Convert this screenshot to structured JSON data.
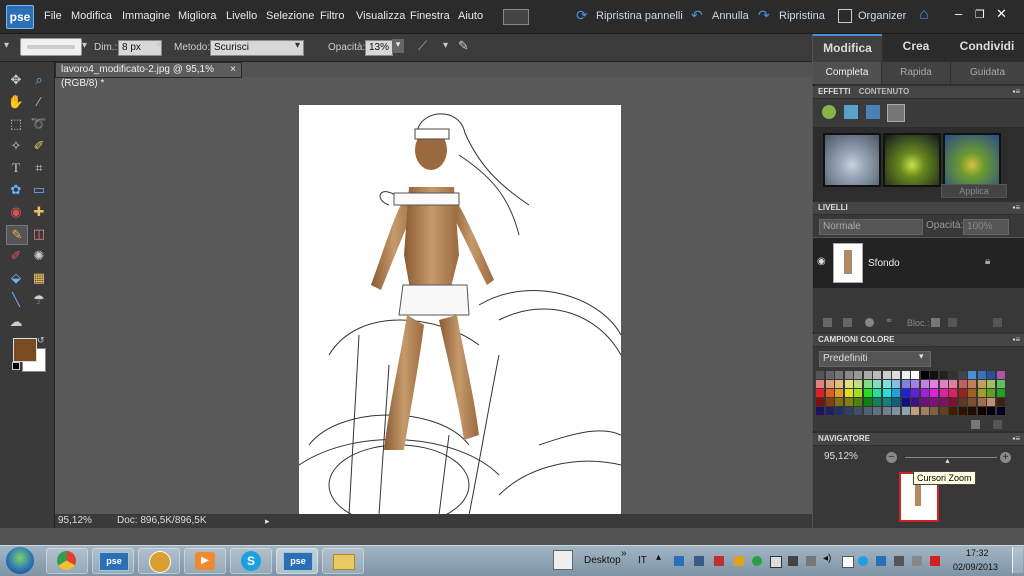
{
  "app": {
    "logo_text": "pse"
  },
  "menu": [
    "File",
    "Modifica",
    "Immagine",
    "Migliora",
    "Livello",
    "Selezione",
    "Filtro",
    "Visualizza",
    "Finestra",
    "Aiuto"
  ],
  "menu_right": {
    "reset_panels": "Ripristina pannelli",
    "undo": "Annulla",
    "redo": "Ripristina",
    "organizer": "Organizer"
  },
  "options": {
    "size_label": "Dim.:",
    "size_value": "8 px",
    "method_label": "Metodo:",
    "method_value": "Scurisci",
    "opacity_label": "Opacità:",
    "opacity_value": "13%"
  },
  "document": {
    "tab_title": "lavoro4_modificato-2.jpg @ 95,1% (RGB/8) *",
    "tab_close": "×",
    "zoom": "95,12%",
    "doc_info": "Doc: 896,5K/896,5K"
  },
  "panel": {
    "tabs": [
      "Modifica",
      "Crea",
      "Condividi"
    ],
    "subtabs": [
      "Completa",
      "Rapida",
      "Guidata"
    ],
    "effects": {
      "header_tabs": [
        "EFFETTI",
        "CONTENUTO"
      ],
      "apply": "Applica"
    },
    "layers": {
      "header": "LIVELLI",
      "blend_mode": "Normale",
      "opacity_label": "Opacità:",
      "opacity_value": "100%",
      "layer_name": "Sfondo",
      "lock_label": "Bloc.:"
    },
    "swatches": {
      "header": "CAMPIONI COLORE",
      "preset": "Predefiniti"
    },
    "navigator": {
      "header": "NAVIGATORE",
      "zoom": "95,12%",
      "tooltip": "Cursori Zoom"
    }
  },
  "taskbar": {
    "desktop": "Desktop",
    "lang": "IT",
    "time": "17:32",
    "date": "02/09/2013",
    "pse1": "pse",
    "pse2": "pse"
  },
  "colors": {
    "foreground": "#7a4b22",
    "background": "#ffffff",
    "accent": "#4a90d9"
  }
}
